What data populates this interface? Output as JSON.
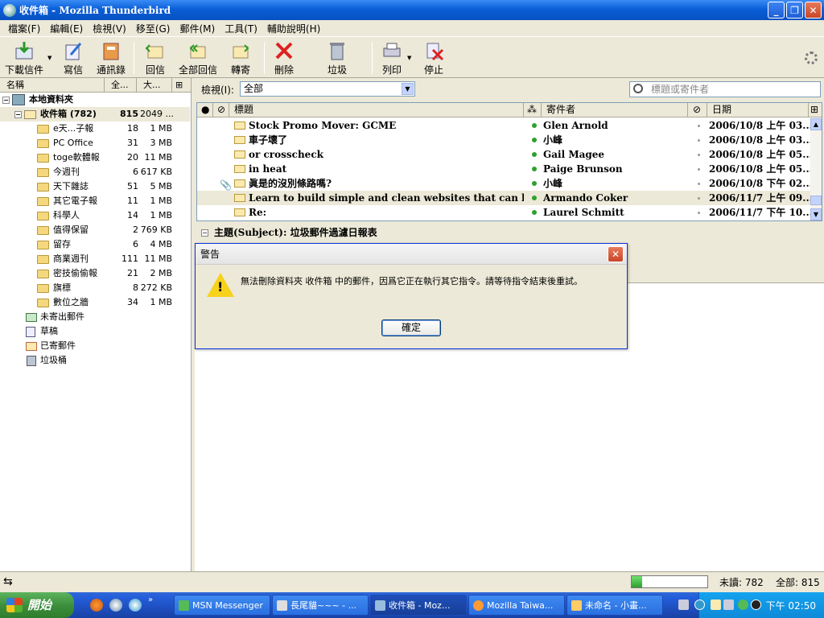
{
  "window": {
    "title": "收件箱 - Mozilla Thunderbird"
  },
  "menu": [
    "檔案(F)",
    "編輯(E)",
    "檢視(V)",
    "移至(G)",
    "郵件(M)",
    "工具(T)",
    "輔助說明(H)"
  ],
  "toolbar": {
    "getmail": "下載信件",
    "write": "寫信",
    "addressbook": "通訊錄",
    "reply": "回信",
    "replyall": "全部回信",
    "forward": "轉寄",
    "delete": "刪除",
    "junk": "垃圾",
    "print": "列印",
    "stop": "停止"
  },
  "folder_pane": {
    "col_name": "名稱",
    "col_total": "全...",
    "col_size": "大...",
    "root": "本地資料夾",
    "inbox": {
      "name": "收件箱 (782)",
      "count": "815",
      "size": "2049 ..."
    },
    "subfolders": [
      {
        "name": "e天...子報",
        "count": "18",
        "size": "1 MB"
      },
      {
        "name": "PC Office",
        "count": "31",
        "size": "3 MB"
      },
      {
        "name": "toge軟體報",
        "count": "20",
        "size": "11 MB"
      },
      {
        "name": "今週刊",
        "count": "6",
        "size": "617 KB"
      },
      {
        "name": "天下雜誌",
        "count": "51",
        "size": "5 MB"
      },
      {
        "name": "其它電子報",
        "count": "11",
        "size": "1 MB"
      },
      {
        "name": "科學人",
        "count": "14",
        "size": "1 MB"
      },
      {
        "name": "值得保留",
        "count": "2",
        "size": "769 KB"
      },
      {
        "name": "留存",
        "count": "6",
        "size": "4 MB"
      },
      {
        "name": "商業週刊",
        "count": "111",
        "size": "11 MB"
      },
      {
        "name": "密技偷偷報",
        "count": "21",
        "size": "2 MB"
      },
      {
        "name": "旗標",
        "count": "8",
        "size": "272 KB"
      },
      {
        "name": "數位之牆",
        "count": "34",
        "size": "1 MB"
      }
    ],
    "others": [
      "未寄出郵件",
      "草稿",
      "已寄郵件",
      "垃圾桶"
    ]
  },
  "viewbar": {
    "label": "檢視(I):",
    "selected": "全部",
    "search_placeholder": "標題或寄件者"
  },
  "thread_header": {
    "subject": "標題",
    "sender": "寄件者",
    "date": "日期"
  },
  "messages": [
    {
      "subject": "Stock Promo Mover: GCME",
      "sender": "Glen Arnold",
      "date": "2006/10/8 上午 03...",
      "attach": false,
      "selected": false
    },
    {
      "subject": "車子壞了",
      "sender": "小峰",
      "date": "2006/10/8 上午 03...",
      "attach": false,
      "selected": false
    },
    {
      "subject": "or crosscheck",
      "sender": "Gail Magee",
      "date": "2006/10/8 上午 05...",
      "attach": false,
      "selected": false
    },
    {
      "subject": "in heat",
      "sender": "Paige Brunson",
      "date": "2006/10/8 上午 05...",
      "attach": false,
      "selected": false
    },
    {
      "subject": "眞是的沒別條路嗎?",
      "sender": "小峰",
      "date": "2006/10/8 下午 02...",
      "attach": true,
      "selected": false
    },
    {
      "subject": "Learn to build simple and clean websites that can bring in ...",
      "sender": "Armando Coker",
      "date": "2006/11/7 上午 09...",
      "attach": false,
      "selected": true
    },
    {
      "subject": "Re:",
      "sender": "Laurel Schmitt",
      "date": "2006/11/7 下午 10...",
      "attach": false,
      "selected": false
    }
  ],
  "preview": {
    "subject_line": "主題(Subject): 垃圾郵件過濾日報表"
  },
  "dialog": {
    "title": "警告",
    "message": "無法刪除資料夾 收件箱 中的郵件，因爲它正在執行其它指令。請等待指令結束後重試。",
    "ok": "確定"
  },
  "statusbar": {
    "unread": "未讀: 782",
    "total": "全部: 815",
    "progress": 0.14
  },
  "taskbar": {
    "start": "開始",
    "tasks": [
      "MSN Messenger",
      "長尾貓~~~ - ...",
      "收件箱 - Moz...",
      "Mozilla Taiwa...",
      "未命名 - 小畫..."
    ],
    "clock": "下午 02:50"
  }
}
